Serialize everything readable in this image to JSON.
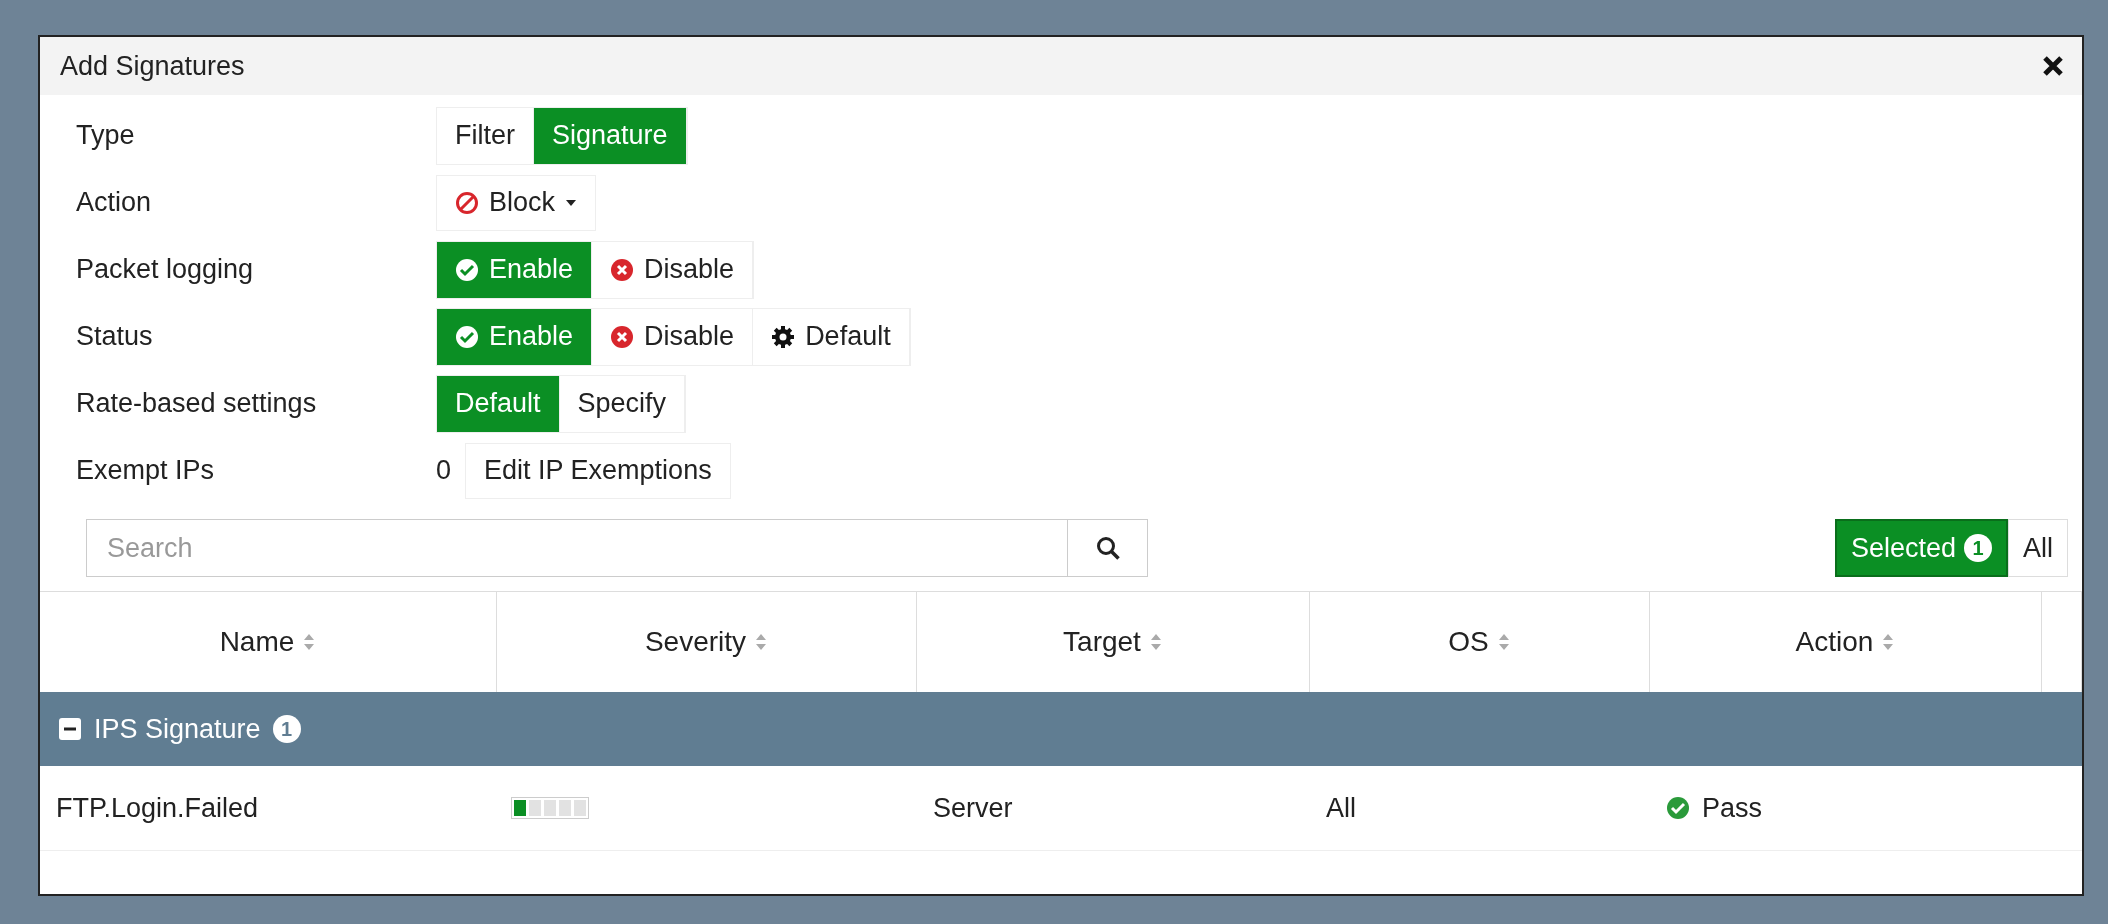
{
  "dialog": {
    "title": "Add Signatures"
  },
  "fields": [
    {
      "kind": "segmented",
      "label": "Type",
      "options": [
        {
          "kind": "plain",
          "label": "Filter",
          "selected": false
        },
        {
          "kind": "plain",
          "label": "Signature",
          "selected": true
        }
      ]
    },
    {
      "kind": "dropdown",
      "label": "Action",
      "value": "Block"
    },
    {
      "kind": "segmented",
      "label": "Packet logging",
      "options": [
        {
          "kind": "enable",
          "label": "Enable",
          "selected": true
        },
        {
          "kind": "disable",
          "label": "Disable",
          "selected": false
        }
      ]
    },
    {
      "kind": "segmented",
      "label": "Status",
      "options": [
        {
          "kind": "enable",
          "label": "Enable",
          "selected": true
        },
        {
          "kind": "disable",
          "label": "Disable",
          "selected": false
        },
        {
          "kind": "default",
          "label": "Default",
          "selected": false
        }
      ]
    },
    {
      "kind": "segmented",
      "label": "Rate-based settings",
      "options": [
        {
          "kind": "plain",
          "label": "Default",
          "selected": true
        },
        {
          "kind": "plain",
          "label": "Specify",
          "selected": false
        }
      ]
    },
    {
      "kind": "exempt",
      "label": "Exempt IPs",
      "count": "0",
      "button": "Edit IP Exemptions"
    }
  ],
  "search": {
    "placeholder": "Search"
  },
  "view_toggle": [
    {
      "label": "Selected",
      "count": "1",
      "selected": true
    },
    {
      "label": "All",
      "selected": false
    }
  ],
  "table": {
    "columns": [
      "Name",
      "Severity",
      "Target",
      "OS",
      "Action"
    ],
    "groups": [
      {
        "label": "IPS Signature",
        "count": "1",
        "expanded": true,
        "rows": [
          {
            "name": "FTP.Login.Failed",
            "severity": {
              "level": 0.2
            },
            "target": "Server",
            "os": "All",
            "action": "Pass"
          }
        ]
      }
    ]
  }
}
